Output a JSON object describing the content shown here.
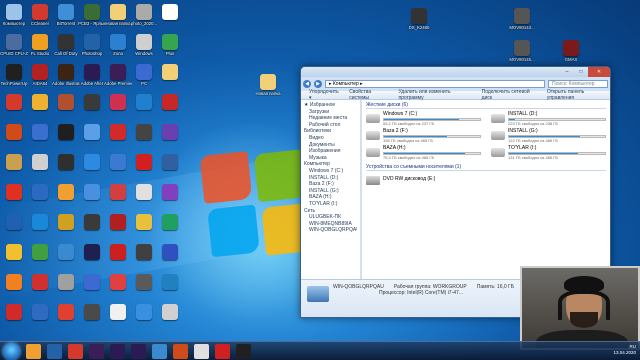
{
  "desktop": {
    "icons": [
      {
        "label": "Компьютер",
        "color": "#9cc4ea"
      },
      {
        "label": "CCleaner",
        "color": "#d23a2f"
      },
      {
        "label": "BitTorrent",
        "color": "#3f8fd8"
      },
      {
        "label": "PCB3 - Ярлык",
        "color": "#3a6c35"
      },
      {
        "label": "Новая папка",
        "color": "#f2d078"
      },
      {
        "label": "photo_2020...",
        "color": "#aaaaaa"
      },
      {
        "label": "",
        "color": "#ffffff"
      },
      {
        "label": "CPUID CPU-Z",
        "color": "#4c6ca0"
      },
      {
        "label": "FL Studio",
        "color": "#f0a020"
      },
      {
        "label": "Call Of Duty",
        "color": "#333333"
      },
      {
        "label": "Photoshop",
        "color": "#2462a8"
      },
      {
        "label": "Zona",
        "color": "#2c80d0"
      },
      {
        "label": "Windows",
        "color": "#cfcfcf"
      },
      {
        "label": "Plus",
        "color": "#35a550"
      },
      {
        "label": "TechPowerUp",
        "color": "#202020"
      },
      {
        "label": "AIDA64",
        "color": "#b22222"
      },
      {
        "label": "Adobe Illustrator",
        "color": "#3b2414"
      },
      {
        "label": "Adobe After",
        "color": "#2a1b55"
      },
      {
        "label": "Adobe Premiere",
        "color": "#3a1e55"
      },
      {
        "label": "PC",
        "color": "#3b6ad0"
      },
      {
        "label": "",
        "color": "#f2d078"
      },
      {
        "label": "",
        "color": "#d33a2c"
      },
      {
        "label": "",
        "color": "#f0b030"
      },
      {
        "label": "",
        "color": "#b05030"
      },
      {
        "label": "",
        "color": "#3a3a3a"
      },
      {
        "label": "",
        "color": "#d03050"
      },
      {
        "label": "",
        "color": "#2080d0"
      },
      {
        "label": "",
        "color": "#c62828"
      },
      {
        "label": "",
        "color": "#d04a1a"
      },
      {
        "label": "",
        "color": "#3a6fd0"
      },
      {
        "label": "",
        "color": "#1f1f1f"
      },
      {
        "label": "",
        "color": "#5aa0e8"
      },
      {
        "label": "",
        "color": "#d02a2a"
      },
      {
        "label": "",
        "color": "#444444"
      },
      {
        "label": "",
        "color": "#6a40b0"
      },
      {
        "label": "",
        "color": "#c8a050"
      },
      {
        "label": "",
        "color": "#d0d0d0"
      },
      {
        "label": "",
        "color": "#2f2f2f"
      },
      {
        "label": "",
        "color": "#2d8ae0"
      },
      {
        "label": "",
        "color": "#3a7ad0"
      },
      {
        "label": "",
        "color": "#d02020"
      },
      {
        "label": "",
        "color": "#3060a0"
      },
      {
        "label": "",
        "color": "#e03020"
      },
      {
        "label": "",
        "color": "#2a6ac0"
      },
      {
        "label": "",
        "color": "#f0a030"
      },
      {
        "label": "",
        "color": "#4a90e0"
      },
      {
        "label": "",
        "color": "#d04040"
      },
      {
        "label": "",
        "color": "#e0e0e0"
      },
      {
        "label": "",
        "color": "#8040c0"
      },
      {
        "label": "",
        "color": "#2060b0"
      },
      {
        "label": "",
        "color": "#1a88d8"
      },
      {
        "label": "",
        "color": "#d0a020"
      },
      {
        "label": "",
        "color": "#3a3a3a"
      },
      {
        "label": "",
        "color": "#b02020"
      },
      {
        "label": "",
        "color": "#e8c040"
      },
      {
        "label": "",
        "color": "#20a060"
      },
      {
        "label": "",
        "color": "#f0c030"
      },
      {
        "label": "",
        "color": "#40a040"
      },
      {
        "label": "",
        "color": "#3a8ad0"
      },
      {
        "label": "",
        "color": "#202050"
      },
      {
        "label": "",
        "color": "#cc2020"
      },
      {
        "label": "",
        "color": "#404040"
      },
      {
        "label": "",
        "color": "#3050c0"
      },
      {
        "label": "",
        "color": "#f08020"
      },
      {
        "label": "",
        "color": "#d03030"
      },
      {
        "label": "",
        "color": "#a0a0a0"
      },
      {
        "label": "",
        "color": "#3b6ad0"
      },
      {
        "label": "",
        "color": "#e04040"
      },
      {
        "label": "",
        "color": "#5a5a5a"
      },
      {
        "label": "",
        "color": "#2080c0"
      },
      {
        "label": "",
        "color": "#d02a2a"
      },
      {
        "label": "",
        "color": "#2f6bc0"
      },
      {
        "label": "",
        "color": "#e04030"
      },
      {
        "label": "",
        "color": "#4a4a4a"
      },
      {
        "label": "",
        "color": "#f0f0f0"
      },
      {
        "label": "",
        "color": "#3a90e0"
      },
      {
        "label": "",
        "color": "#d0d0d0"
      }
    ],
    "right_icons": [
      {
        "label": "DS_K2480",
        "color": "#333333"
      },
      {
        "label": "MOV80143...",
        "color": "#555555"
      },
      {
        "label": "GMAX",
        "color": "#7a1a1a"
      },
      {
        "label": "MOV80145...",
        "color": "#555555"
      }
    ],
    "folder_icon": {
      "label": "Новая папка",
      "color": "#f2d078"
    }
  },
  "explorer": {
    "address": "▸ Компьютер ▸",
    "search_placeholder": "Поиск: Компьютер",
    "commands": [
      "Упорядочить ▾",
      "Свойства системы",
      "Удалить или изменить программу",
      "Подключить сетевой диск",
      "Открыть панель управления"
    ],
    "nav": [
      {
        "label": "★ Избранное",
        "sub": false
      },
      {
        "label": "Загрузки",
        "sub": true
      },
      {
        "label": "Недавние места",
        "sub": true
      },
      {
        "label": "Рабочий стол",
        "sub": true
      },
      {
        "label": "Библиотеки",
        "sub": false
      },
      {
        "label": "Видео",
        "sub": true
      },
      {
        "label": "Документы",
        "sub": true
      },
      {
        "label": "Изображения",
        "sub": true
      },
      {
        "label": "Музыка",
        "sub": true
      },
      {
        "label": "Компьютер",
        "sub": false
      },
      {
        "label": "Windows 7 (C:)",
        "sub": true
      },
      {
        "label": "INSTALL (D:)",
        "sub": true
      },
      {
        "label": "Baza 2 (F:)",
        "sub": true
      },
      {
        "label": "INSTALL (G:)",
        "sub": true
      },
      {
        "label": "BAZA (H:)",
        "sub": true
      },
      {
        "label": "TO'YLAR (I:)",
        "sub": true
      },
      {
        "label": "Сеть",
        "sub": false
      },
      {
        "label": "ULUGBEK-ПК",
        "sub": true
      },
      {
        "label": "WIN-8MEQNB89IA",
        "sub": true
      },
      {
        "label": "WIN-QOBGLQRPQAU",
        "sub": true
      }
    ],
    "hdd_group": "Жесткие диски (6)",
    "drives": [
      {
        "name": "Windows 7 (C:)",
        "free": "53,2 ГБ свободно из 237 ГБ",
        "used": 0.78
      },
      {
        "name": "INSTALL (D:)",
        "free": "223 ГБ свободно из 238 ГБ",
        "used": 0.06
      },
      {
        "name": "Baza 2 (F:)",
        "free": "156 ГБ свободно из 465 ГБ",
        "used": 0.66
      },
      {
        "name": "INSTALL (G:)",
        "free": "122 ГБ свободно из 465 ГБ",
        "used": 0.74
      },
      {
        "name": "BAZA (H:)",
        "free": "75,3 ГБ свободно из 465 ГБ",
        "used": 0.84
      },
      {
        "name": "TO'YLAR (I:)",
        "free": "131 ГБ свободно из 465 ГБ",
        "used": 0.72
      }
    ],
    "removable_group": "Устройства со съемными носителями (1)",
    "dvd": "DVD RW дисковод (E:)",
    "details": {
      "name": "WIN-QOBGLQRPQAU",
      "workgroup": "Рабочая группа: WORKGROUP",
      "memory": "Память: 16,0 ГБ",
      "cpu": "Процессор: Intel(R) Core(TM) i7-47..."
    }
  },
  "taskbar": {
    "apps": [
      "#f0a030",
      "#2462a8",
      "#d33a2c",
      "#3a1e55",
      "#2a1b55",
      "#2a1b55",
      "#3a8ad0",
      "#d04a1a",
      "#e0e0e0",
      "#d02020",
      "#202020"
    ],
    "lang": "RU",
    "date": "13.04.2020"
  }
}
